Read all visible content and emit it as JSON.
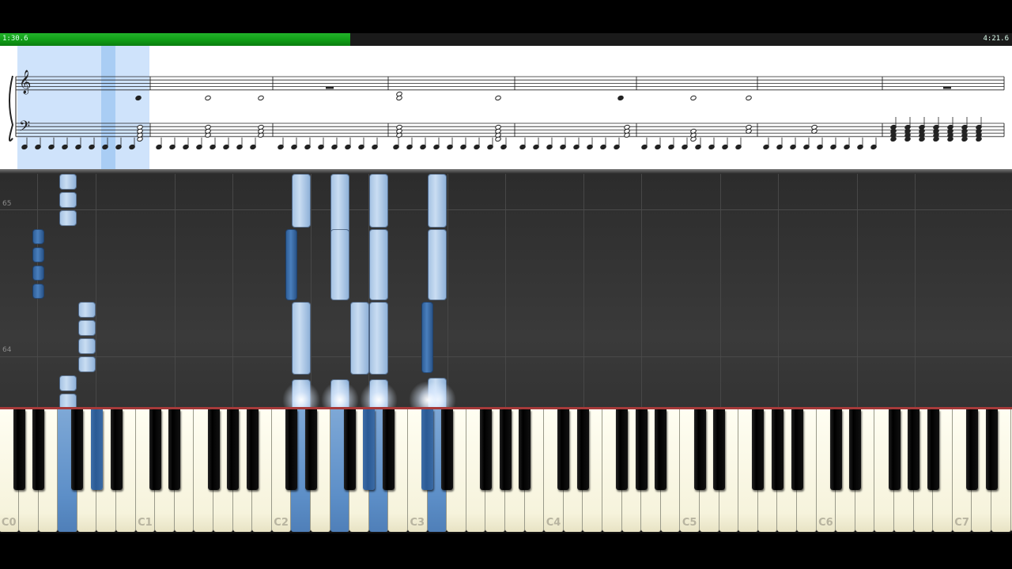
{
  "playback": {
    "current_time": "1:30.6",
    "total_time": "4:21.6",
    "progress_fraction": 0.346,
    "accent_color": "#22b32a"
  },
  "sheet": {
    "highlight_color": "#cfe3fb"
  },
  "roll": {
    "measure_numbers": [
      "65",
      "64"
    ]
  },
  "keyboard": {
    "octave_labels": [
      "C0",
      "C1",
      "C2",
      "C3",
      "C4",
      "C5",
      "C6",
      "C7"
    ],
    "active_white_keys": [
      "F0",
      "D2",
      "F2",
      "A2",
      "D3"
    ],
    "active_black_keys": [
      "G#0",
      "G#2",
      "C#3"
    ],
    "active_color": "#5d8fc8"
  }
}
